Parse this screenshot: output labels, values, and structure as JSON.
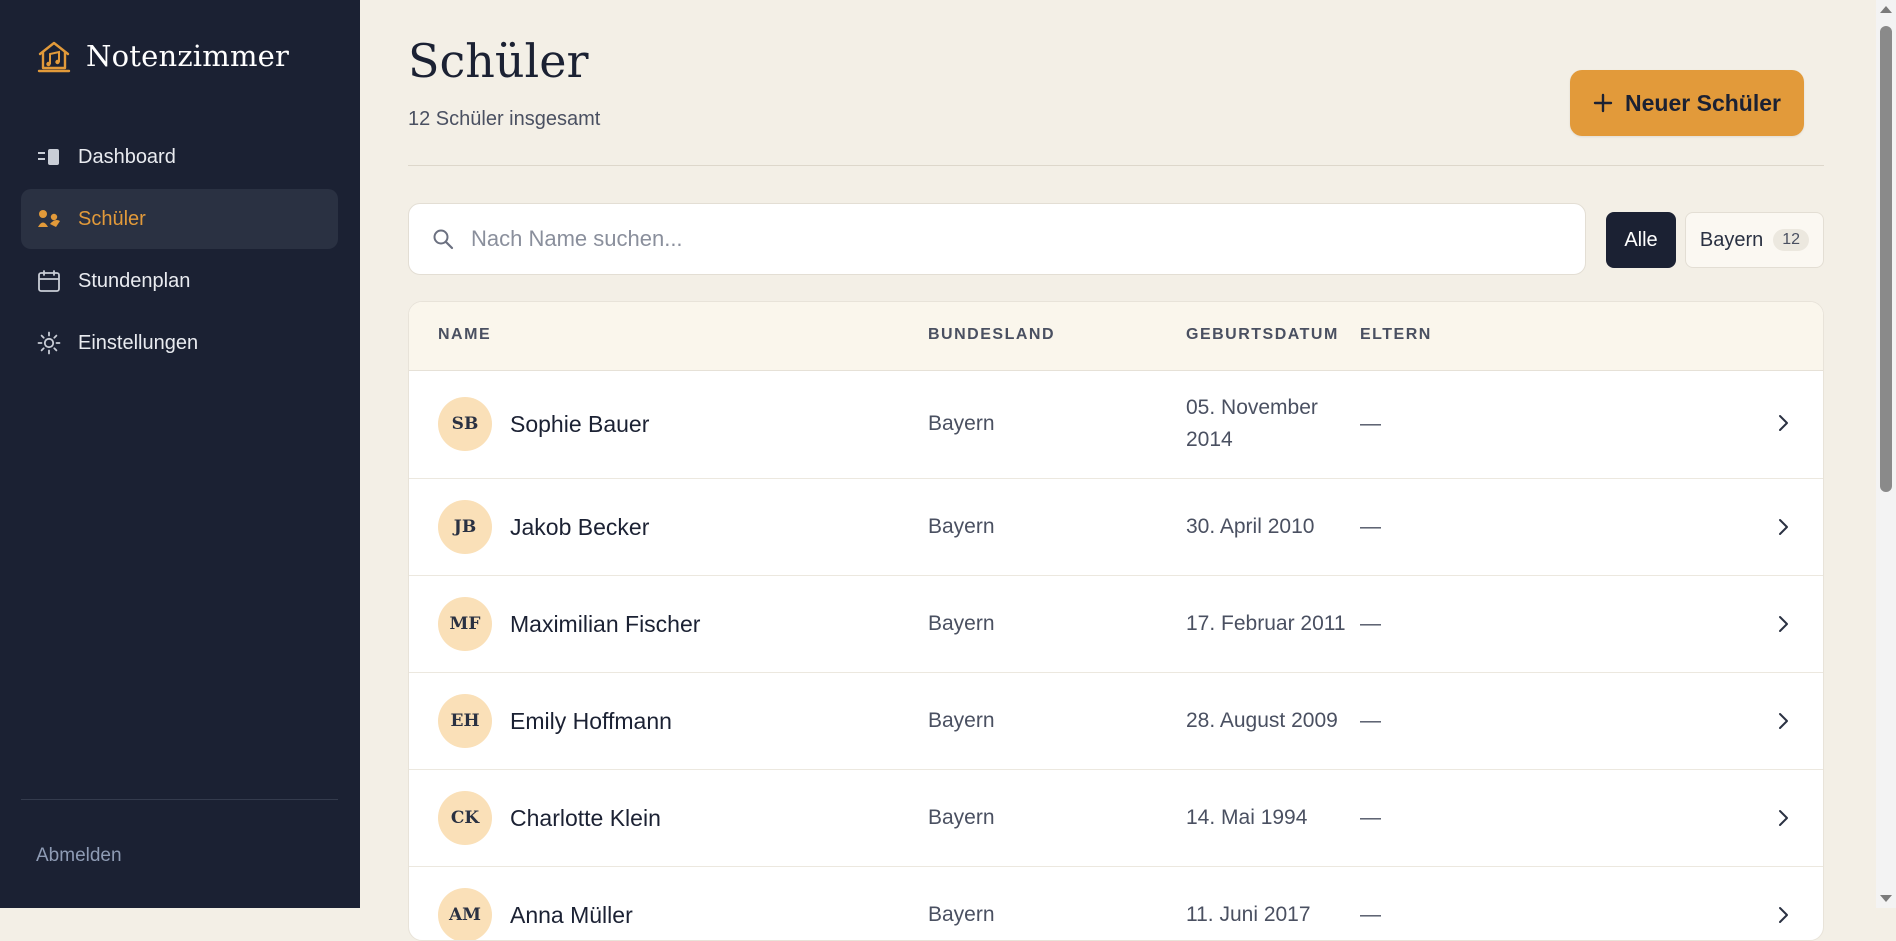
{
  "brand": {
    "name": "Notenzimmer",
    "icon": "music-house-icon",
    "accent": "#e29a3a"
  },
  "nav": [
    {
      "label": "Dashboard",
      "icon": "dashboard-icon",
      "active": false
    },
    {
      "label": "Schüler",
      "icon": "students-icon",
      "active": true
    },
    {
      "label": "Stundenplan",
      "icon": "calendar-icon",
      "active": false
    },
    {
      "label": "Einstellungen",
      "icon": "gear-icon",
      "active": false
    }
  ],
  "logout_label": "Abmelden",
  "page": {
    "title": "Schüler",
    "subtitle": "12 Schüler insgesamt",
    "new_button_label": "Neuer Schüler"
  },
  "search": {
    "placeholder": "Nach Name suchen..."
  },
  "filters": {
    "all_label": "Alle",
    "state_label": "Bayern",
    "state_count": "12"
  },
  "table": {
    "headers": {
      "name": "NAME",
      "state": "BUNDESLAND",
      "birth": "GEBURTSDATUM",
      "parents": "ELTERN"
    },
    "rows": [
      {
        "initials": "SB",
        "name": "Sophie Bauer",
        "state": "Bayern",
        "birth": "05. November 2014",
        "parents": "—"
      },
      {
        "initials": "JB",
        "name": "Jakob Becker",
        "state": "Bayern",
        "birth": "30. April 2010",
        "parents": "—"
      },
      {
        "initials": "MF",
        "name": "Maximilian Fischer",
        "state": "Bayern",
        "birth": "17. Februar 2011",
        "parents": "—"
      },
      {
        "initials": "EH",
        "name": "Emily Hoffmann",
        "state": "Bayern",
        "birth": "28. August 2009",
        "parents": "—"
      },
      {
        "initials": "CK",
        "name": "Charlotte Klein",
        "state": "Bayern",
        "birth": "14. Mai 1994",
        "parents": "—"
      },
      {
        "initials": "AM",
        "name": "Anna Müller",
        "state": "Bayern",
        "birth": "11. Juni 2017",
        "parents": "—"
      }
    ]
  }
}
